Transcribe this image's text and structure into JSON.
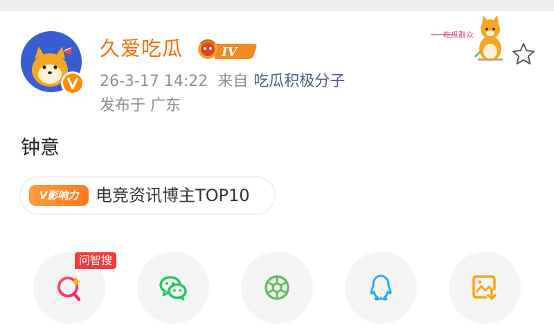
{
  "post": {
    "username": "久爱吃瓜",
    "level_badge": "IV",
    "timestamp": "26-3-17 14:22",
    "source_prefix": "来自",
    "source": "吃瓜积极分子",
    "location": "发布于 广东",
    "content": "钟意"
  },
  "influence": {
    "badge_label": "影响力",
    "text": "电竞资讯博主TOP10"
  },
  "sticker": {
    "text": "吃瓜群众"
  },
  "share": {
    "items": [
      {
        "name": "ai-search",
        "icon": "ai-search-icon",
        "tag": "问智搜"
      },
      {
        "name": "wechat",
        "icon": "wechat-icon"
      },
      {
        "name": "moments",
        "icon": "moments-icon"
      },
      {
        "name": "qq",
        "icon": "qq-icon"
      },
      {
        "name": "save-image",
        "icon": "save-image-icon"
      }
    ]
  },
  "colors": {
    "username": "#ff6a00",
    "source_link": "#4b5c8a",
    "meta_gray": "#8f8f8f",
    "influence_orange": "#ff8a2a",
    "ai_tag_red": "#f23a3a",
    "wechat_green": "#22c55e",
    "moments_green": "#5cc05c",
    "qq_blue": "#2ea7f5",
    "save_orange": "#ffa11a"
  }
}
